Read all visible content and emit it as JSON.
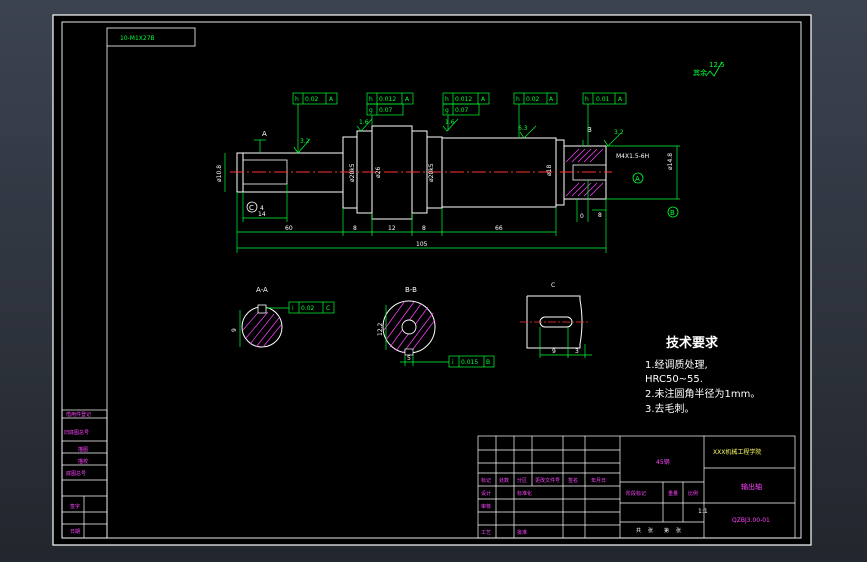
{
  "frame_label": "10-M1X27B",
  "roughness_other": "12.5",
  "roughness_other_label": "其余",
  "section_labels": {
    "aa": "A-A",
    "bb": "B-B",
    "c": "C"
  },
  "tolerance_frames": [
    {
      "sym": "h",
      "val": "0.02",
      "ref": "A"
    },
    {
      "sym": "h",
      "val": "0.012",
      "ref": "A"
    },
    {
      "sym": "g",
      "val": "0.07",
      "ref": ""
    },
    {
      "sym": "h",
      "val": "0.012",
      "ref": "A"
    },
    {
      "sym": "g",
      "val": "0.07",
      "ref": ""
    },
    {
      "sym": "h",
      "val": "0.02",
      "ref": "A"
    },
    {
      "sym": "h",
      "val": "0.01",
      "ref": "A"
    }
  ],
  "roughness_marks": [
    "3.2",
    "1.6",
    "1.6",
    "6.3",
    "3.2"
  ],
  "dimensions": {
    "d1": "60",
    "d2": "8",
    "d3": "12",
    "d4": "8",
    "d5": "66",
    "total": "105",
    "key14": "14",
    "key4": "4",
    "shank": "ø10.8",
    "dia1": "ø20k5",
    "dia2": "ø26",
    "dia3": "ø20k5",
    "dia4": "ø18",
    "thread": "M4X1.5-6H",
    "thread_depth": "8",
    "end_dia": "ø14.8",
    "end0": "0",
    "aa_tol": "0.02",
    "aa_ref": "C",
    "aa_size": "9",
    "bb_tol": "0.015",
    "bb_ref": "B",
    "bb_size": "12.2",
    "bb_key": "5",
    "c_w": "9",
    "c_w2": "3"
  },
  "datum_labels": {
    "a": "A",
    "b": "B",
    "c": "C"
  },
  "technical_requirements": {
    "title": "技术要求",
    "items": [
      "1.经调质处理,",
      "HRC50~55.",
      "2.未注圆角半径为1mm。",
      "3.去毛刺。"
    ]
  },
  "title_block": {
    "school": "XXX机械工程学院",
    "part_name": "输出轴",
    "material": "45钢",
    "drawing_no": "QZBJ3.00-01",
    "labels": [
      "标记",
      "处数",
      "分区",
      "更改文件号",
      "签名",
      "年月日"
    ],
    "labels2": [
      "设计",
      "标准化",
      "审核",
      "工艺",
      "批准"
    ],
    "scale_labels": [
      "阶段标记",
      "重量",
      "比例"
    ],
    "scale": "1:1",
    "sheet": [
      "共",
      "张",
      "第",
      "张"
    ]
  },
  "side_table": [
    "借用件登记",
    "旧底图总号",
    "描图",
    "描校",
    "底图总号",
    "签字",
    "日期"
  ]
}
